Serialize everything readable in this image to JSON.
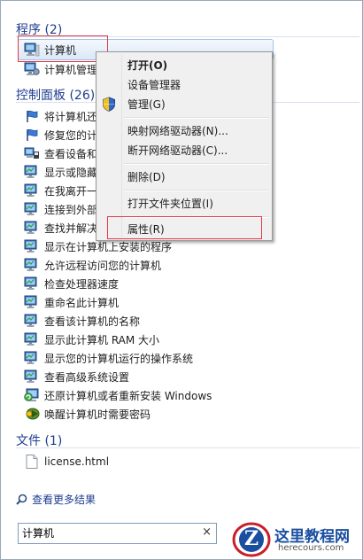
{
  "programs": {
    "header": "程序 (2)",
    "items": [
      {
        "label": "计算机",
        "icon": "computer-icon"
      },
      {
        "label": "计算机管理",
        "icon": "computer-management-icon"
      }
    ]
  },
  "control_panel": {
    "header": "控制面板 (26)",
    "items": [
      {
        "label": "将计算机还",
        "icon": "flag-icon"
      },
      {
        "label": "修复您的计",
        "icon": "flag-icon"
      },
      {
        "label": "查看设备和",
        "icon": "devices-icon"
      },
      {
        "label": "显示或隐藏",
        "icon": "system-icon"
      },
      {
        "label": "在我离开一",
        "icon": "system-icon"
      },
      {
        "label": "连接到外部",
        "icon": "system-icon"
      },
      {
        "label": "查找并解决",
        "icon": "system-icon"
      },
      {
        "label": "显示在计算机上安装的程序",
        "icon": "system-icon"
      },
      {
        "label": "允许远程访问您的计算机",
        "icon": "system-icon"
      },
      {
        "label": "检查处理器速度",
        "icon": "system-icon"
      },
      {
        "label": "重命名此计算机",
        "icon": "system-icon"
      },
      {
        "label": "查看该计算机的名称",
        "icon": "system-icon"
      },
      {
        "label": "显示此计算机 RAM 大小",
        "icon": "system-icon"
      },
      {
        "label": "显示您的计算机运行的操作系统",
        "icon": "system-icon"
      },
      {
        "label": "查看高级系统设置",
        "icon": "system-icon"
      },
      {
        "label": "还原计算机或者重新安装 Windows",
        "icon": "recovery-icon"
      },
      {
        "label": "唤醒计算机时需要密码",
        "icon": "power-icon"
      }
    ]
  },
  "files": {
    "header": "文件 (1)",
    "items": [
      {
        "label": "license.html",
        "icon": "file-icon"
      }
    ]
  },
  "see_more": "查看更多结果",
  "search": {
    "value": "计算机",
    "clear": "×"
  },
  "context_menu": {
    "open": "打开(O)",
    "device_manager": "设备管理器",
    "manage": "管理(G)",
    "map_drive": "映射网络驱动器(N)...",
    "disconnect_drive": "断开网络驱动器(C)...",
    "delete": "删除(D)",
    "open_location": "打开文件夹位置(I)",
    "properties": "属性(R)"
  },
  "watermark": {
    "name": "这里教程网",
    "url": "herecours.com",
    "badge": "Z"
  },
  "colors": {
    "header": "#1e3d8f",
    "highlight_box": "#e03a4a",
    "watermark": "#1a4fa0"
  }
}
